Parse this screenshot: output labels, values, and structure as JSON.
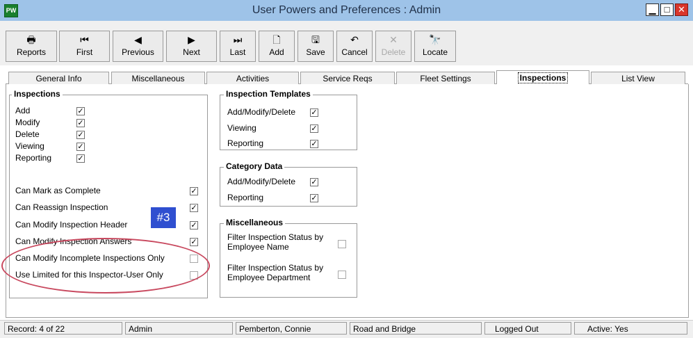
{
  "window": {
    "title": "User Powers and Preferences : Admin",
    "app_icon_text": "PW",
    "controls": [
      "minimize",
      "maximize",
      "close"
    ]
  },
  "toolbar": [
    {
      "label": "Reports",
      "icon": "printer-icon",
      "glyph": "🖶",
      "enabled": true
    },
    {
      "label": "First",
      "icon": "first-record-icon",
      "glyph": "⏮",
      "enabled": true
    },
    {
      "label": "Previous",
      "icon": "previous-record-icon",
      "glyph": "◀",
      "enabled": true
    },
    {
      "label": "Next",
      "icon": "next-record-icon",
      "glyph": "▶",
      "enabled": true
    },
    {
      "label": "Last",
      "icon": "last-record-icon",
      "glyph": "⏭",
      "enabled": true
    },
    {
      "label": "Add",
      "icon": "new-document-icon",
      "glyph": "🗋",
      "enabled": true
    },
    {
      "label": "Save",
      "icon": "floppy-disk-icon",
      "glyph": "🖫",
      "enabled": true
    },
    {
      "label": "Cancel",
      "icon": "undo-icon",
      "glyph": "↶",
      "enabled": true
    },
    {
      "label": "Delete",
      "icon": "delete-x-icon",
      "glyph": "✕",
      "enabled": false
    },
    {
      "label": "Locate",
      "icon": "binoculars-icon",
      "glyph": "🔭",
      "enabled": true
    }
  ],
  "tabs": [
    {
      "label": "General Info",
      "active": false
    },
    {
      "label": "Miscellaneous",
      "active": false
    },
    {
      "label": "Activities",
      "active": false
    },
    {
      "label": "Service Reqs",
      "active": false
    },
    {
      "label": "Fleet Settings",
      "active": false
    },
    {
      "label": "Inspections",
      "active": true
    },
    {
      "label": "List View",
      "active": false
    }
  ],
  "inspections_group": {
    "title": "Inspections",
    "basic": [
      {
        "label": "Add",
        "checked": true
      },
      {
        "label": "Modify",
        "checked": true
      },
      {
        "label": "Delete",
        "checked": true
      },
      {
        "label": "Viewing",
        "checked": true
      },
      {
        "label": "Reporting",
        "checked": true
      }
    ],
    "advanced": [
      {
        "label": "Can Mark as Complete",
        "checked": true
      },
      {
        "label": "Can Reassign Inspection",
        "checked": true
      },
      {
        "label": "Can Modify Inspection Header",
        "checked": true
      },
      {
        "label": "Can Modify Inspection Answers",
        "checked": true
      },
      {
        "label": "Can Modify Incomplete Inspections Only",
        "checked": false
      },
      {
        "label": "Use Limited for this Inspector-User Only",
        "checked": false
      }
    ]
  },
  "templates_group": {
    "title": "Inspection Templates",
    "items": [
      {
        "label": "Add/Modify/Delete",
        "checked": true
      },
      {
        "label": "Viewing",
        "checked": true
      },
      {
        "label": "Reporting",
        "checked": true
      }
    ]
  },
  "category_group": {
    "title": "Category Data",
    "items": [
      {
        "label": "Add/Modify/Delete",
        "checked": true
      },
      {
        "label": "Reporting",
        "checked": true
      }
    ]
  },
  "misc_group": {
    "title": "Miscellaneous",
    "items": [
      {
        "label": "Filter Inspection Status by",
        "label2": "Employee Name",
        "checked": false
      },
      {
        "label": "Filter Inspection Status by",
        "label2": "Employee Department",
        "checked": false
      }
    ]
  },
  "annotation": {
    "badge": "#3",
    "badge_color": "#2f4fd0",
    "circle_color": "#c8485e"
  },
  "status": {
    "record": "Record: 4 of 22",
    "user": "Admin",
    "employee": "Pemberton, Connie",
    "department": "Road and Bridge",
    "login_state": "Logged Out",
    "active": "Active: Yes"
  }
}
